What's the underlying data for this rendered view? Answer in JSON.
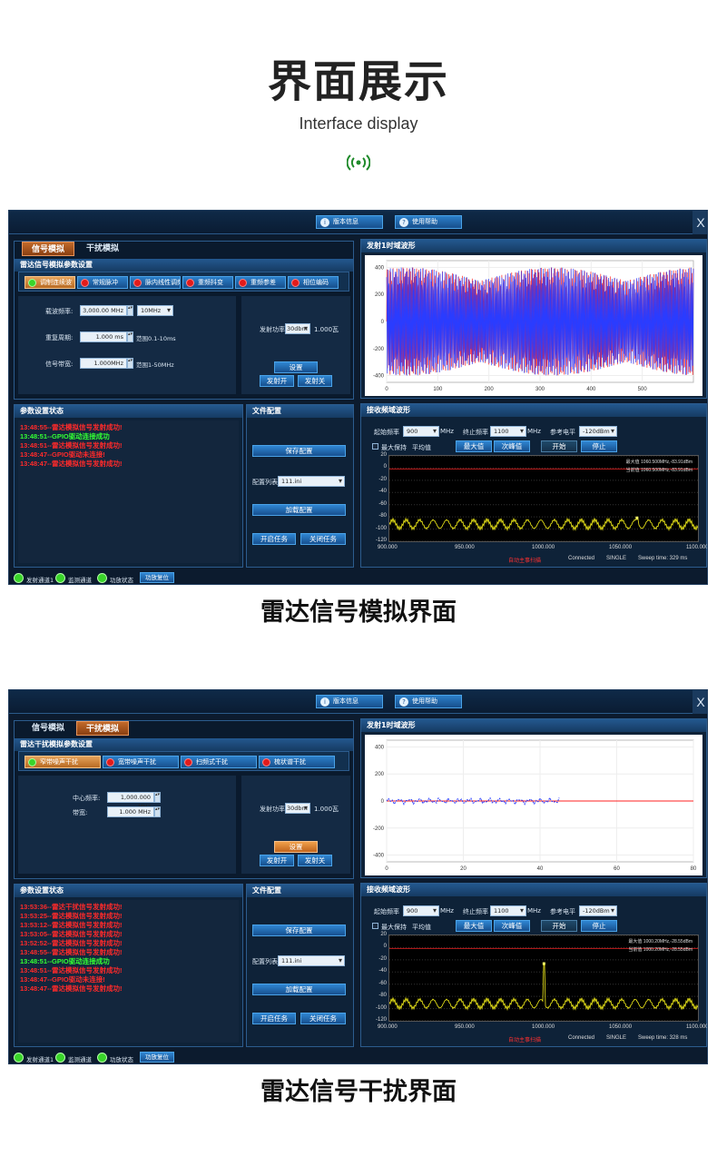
{
  "header": {
    "title": "界面展示",
    "subtitle": "Interface display"
  },
  "screens": [
    {
      "caption": "雷达信号模拟界面",
      "topbar": {
        "version_btn": "版本信息",
        "help_btn": "使用帮助",
        "close": "X"
      },
      "tabs": [
        {
          "label": "信号模拟",
          "active": true
        },
        {
          "label": "干扰模拟",
          "active": false
        }
      ],
      "settings_title": "雷达信号模拟参数设置",
      "modes": [
        "调制连续波",
        "常规脉冲",
        "脉内线性调频",
        "重频抖变",
        "重频参差",
        "相位编码"
      ],
      "selected_mode": 0,
      "params": [
        {
          "label": "载波频率:",
          "value": "3,000.00 MHz",
          "extra_combo": "10MHz",
          "range": ""
        },
        {
          "label": "重复周期:",
          "value": "1.000 ms",
          "range": "范围0.1-10ms"
        },
        {
          "label": "信号带宽:",
          "value": "1.000MHz",
          "range": "范围1-50MHz"
        }
      ],
      "power": {
        "label": "发射功率",
        "value": "30dbm",
        "unit": "1.000瓦"
      },
      "buttons": {
        "set": "设置",
        "tx_on": "发射开",
        "tx_off": "发射关"
      },
      "status_title": "参数设置状态",
      "logs": [
        {
          "text": "13:48:55--雷达模拟信号发射成功!",
          "color": "#ff2a2a"
        },
        {
          "text": "13:48:51--GPIO驱动连接成功",
          "color": "#33ff33"
        },
        {
          "text": "13:48:51--雷达模拟信号发射成功!",
          "color": "#ff2a2a"
        },
        {
          "text": "13:48:47--GPIO驱动未连接!",
          "color": "#ff2a2a"
        },
        {
          "text": "13:48:47--雷达模拟信号发射成功!",
          "color": "#ff2a2a"
        }
      ],
      "file": {
        "title": "文件配置",
        "save": "保存配置",
        "list_label": "配置列表",
        "list_value": "111.ini",
        "load": "加载配置",
        "start": "开启任务",
        "stop": "关闭任务"
      },
      "status_bar": [
        "发射通道1",
        "监测通道",
        "功放状态"
      ],
      "status_btn": "功放复位",
      "wave_title": "发射1时域波形",
      "wave_chart": {
        "type": "line",
        "x_ticks": [
          "0",
          "100",
          "200",
          "300",
          "400",
          "500"
        ],
        "y_ticks": [
          "400",
          "200",
          "0",
          "-200",
          "-400"
        ],
        "xlim": [
          0,
          600
        ],
        "ylim": [
          -450,
          450
        ],
        "series": [
          {
            "color": "#ff2020",
            "amplitude": 400
          },
          {
            "color": "#2a3cff",
            "amplitude": 400
          }
        ]
      },
      "spec": {
        "title": "接收频域波形",
        "start_label": "起始频率",
        "start_value": "900",
        "start_unit": "MHz",
        "stop_label": "终止频率",
        "stop_value": "1100",
        "stop_unit": "MHz",
        "ref_label": "参考电平",
        "ref_value": "-120dBm",
        "maxhold": "最大保持",
        "avg": "平均值",
        "max_btn": "最大值",
        "next_btn": "次峰值",
        "start_btn": "开始",
        "stop_btn": "停止",
        "y_ticks": [
          "20",
          "0",
          "-20",
          "-40",
          "-60",
          "-80",
          "-100",
          "-120"
        ],
        "x_ticks": [
          "900.000",
          "950.000",
          "1000.000",
          "1050.000",
          "1100.000"
        ],
        "marker1": "最大值 1060.500MHz,-83.91dBm",
        "marker2": "当前值 1060.500MHz,-83.91dBm",
        "footer_red": "自动主事扫描",
        "footer": [
          "Connected",
          "SINGLE",
          "Sweep time: 329 ms"
        ],
        "peak_x": 1060.5
      }
    },
    {
      "caption": "雷达信号干扰界面",
      "topbar": {
        "version_btn": "版本信息",
        "help_btn": "使用帮助",
        "close": "X"
      },
      "tabs": [
        {
          "label": "信号模拟",
          "active": false
        },
        {
          "label": "干扰模拟",
          "active": true
        }
      ],
      "settings_title": "雷达干扰模拟参数设置",
      "modes": [
        "窄带噪声干扰",
        "宽带噪声干扰",
        "扫频式干扰",
        "梳状谱干扰"
      ],
      "selected_mode": 0,
      "params": [
        {
          "label": "中心频率:",
          "value": "1,000.000 MHz",
          "range": ""
        },
        {
          "label": "带宽:",
          "value": "1.000 MHz",
          "range": ""
        }
      ],
      "power": {
        "label": "发射功率",
        "value": "30dbm",
        "unit": "1.000瓦"
      },
      "buttons": {
        "set": "设置",
        "tx_on": "发射开",
        "tx_off": "发射关"
      },
      "status_title": "参数设置状态",
      "logs": [
        {
          "text": "13:53:36--雷达干扰信号发射成功!",
          "color": "#ff2a2a"
        },
        {
          "text": "13:53:25--雷达模拟信号发射成功!",
          "color": "#ff2a2a"
        },
        {
          "text": "13:53:12--雷达模拟信号发射成功!",
          "color": "#ff2a2a"
        },
        {
          "text": "13:53:05--雷达模拟信号发射成功!",
          "color": "#ff2a2a"
        },
        {
          "text": "13:52:52--雷达模拟信号发射成功!",
          "color": "#ff2a2a"
        },
        {
          "text": "13:48:55--雷达模拟信号发射成功!",
          "color": "#ff2a2a"
        },
        {
          "text": "13:48:51--GPIO驱动连接成功",
          "color": "#33ff33"
        },
        {
          "text": "13:48:51--雷达模拟信号发射成功!",
          "color": "#ff2a2a"
        },
        {
          "text": "13:48:47--GPIO驱动未连接!",
          "color": "#ff2a2a"
        },
        {
          "text": "13:48:47--雷达模拟信号发射成功!",
          "color": "#ff2a2a"
        }
      ],
      "file": {
        "title": "文件配置",
        "save": "保存配置",
        "list_label": "配置列表",
        "list_value": "111.ini",
        "load": "加载配置",
        "start": "开启任务",
        "stop": "关闭任务"
      },
      "status_bar": [
        "发射通道1",
        "监测通道",
        "功放状态"
      ],
      "status_btn": "功放复位",
      "wave_title": "发射1时域波形",
      "wave_chart": {
        "type": "line",
        "x_ticks": [
          "0",
          "20",
          "40",
          "60",
          "80"
        ],
        "y_ticks": [
          "400",
          "200",
          "0",
          "-200",
          "-400"
        ],
        "xlim": [
          0,
          80
        ],
        "ylim": [
          -450,
          450
        ],
        "series": [
          {
            "color": "#ff2020",
            "amplitude": 0
          },
          {
            "color": "#2a3cff",
            "amplitude": 25
          }
        ]
      },
      "spec": {
        "title": "接收频域波形",
        "start_label": "起始频率",
        "start_value": "900",
        "start_unit": "MHz",
        "stop_label": "终止频率",
        "stop_value": "1100",
        "stop_unit": "MHz",
        "ref_label": "参考电平",
        "ref_value": "-120dBm",
        "maxhold": "最大保持",
        "avg": "平均值",
        "max_btn": "最大值",
        "next_btn": "次峰值",
        "start_btn": "开始",
        "stop_btn": "停止",
        "y_ticks": [
          "20",
          "0",
          "-20",
          "-40",
          "-60",
          "-80",
          "-100",
          "-120"
        ],
        "x_ticks": [
          "900.000",
          "950.000",
          "1000.000",
          "1050.000",
          "1100.000"
        ],
        "marker1": "最大值 1000.20MHz,-28.55dBm",
        "marker2": "当前值 1000.20MHz,-28.55dBm",
        "footer_red": "自动主事扫描",
        "footer": [
          "Connected",
          "SINGLE",
          "Sweep time: 328 ms"
        ],
        "peak_x": 1000.2
      }
    }
  ]
}
